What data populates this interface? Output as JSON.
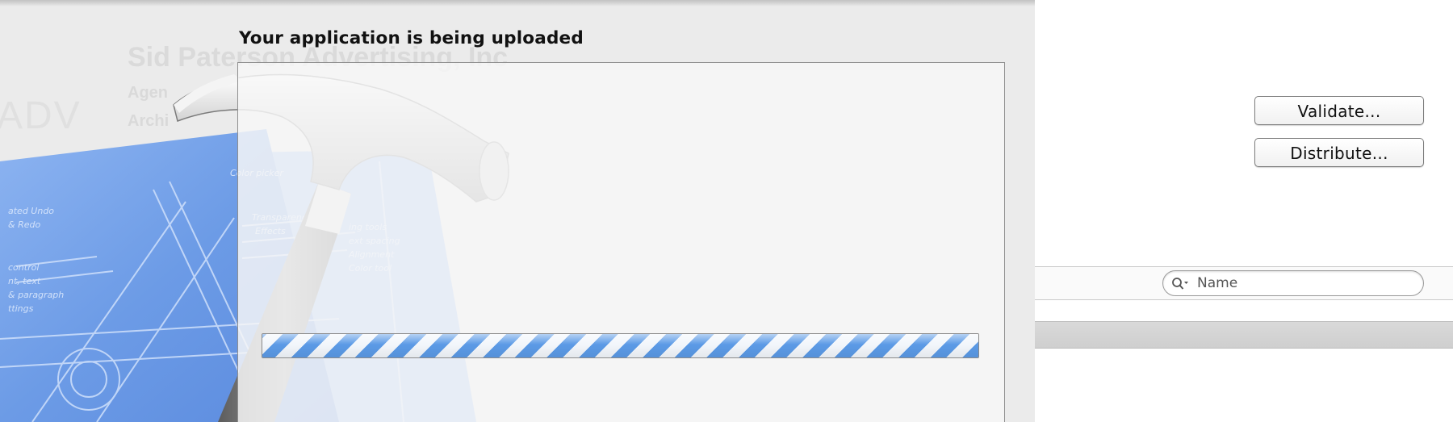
{
  "upload_sheet": {
    "title": "Your application is being uploaded",
    "progress_indeterminate": true
  },
  "background": {
    "company_name": "Sid Paterson Advertising, Inc",
    "agency_label": "Agen",
    "archive_label": "Archi",
    "logo_text": "ADV"
  },
  "organizer": {
    "validate_label": "Validate...",
    "distribute_label": "Distribute...",
    "search": {
      "placeholder": "Name",
      "value": ""
    }
  },
  "colors": {
    "progress_blue": "#5b9ae6",
    "blueprint_blue": "#6f9de8",
    "sheet_background": "#f7f7f7"
  },
  "icons": {
    "search": "magnifying-glass-icon",
    "app_artwork": "xcode-hammer-blueprint-icon"
  }
}
